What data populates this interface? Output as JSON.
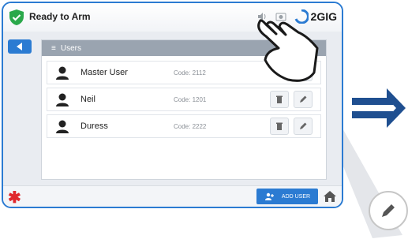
{
  "topbar": {
    "status_text": "Ready to Arm",
    "brand": "2GIG",
    "icons": [
      "shield-check-icon",
      "speaker-icon",
      "camera-icon",
      "2gig-logo-icon"
    ]
  },
  "panel": {
    "title": "Users"
  },
  "users": [
    {
      "name": "Master User",
      "code": "Code: 2112"
    },
    {
      "name": "Neil",
      "code": "Code: 1201"
    },
    {
      "name": "Duress",
      "code": "Code: 2222"
    }
  ],
  "bottombar": {
    "add_user_label": "ADD USER"
  },
  "colors": {
    "accent": "#2b7bd2",
    "status_green": "#2aa84a",
    "emergency": "#e0262b",
    "header_gray": "#9aa4b0"
  }
}
